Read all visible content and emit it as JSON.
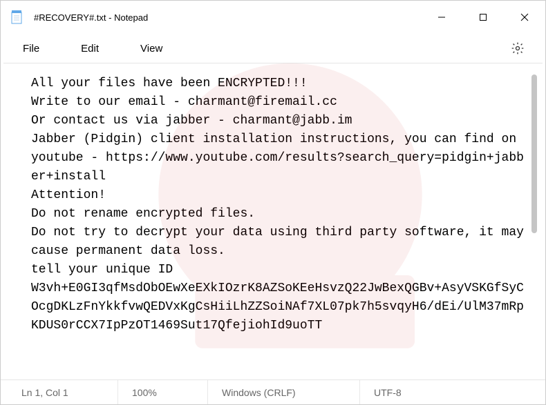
{
  "window": {
    "title": "#RECOVERY#.txt - Notepad"
  },
  "menu": {
    "file": "File",
    "edit": "Edit",
    "view": "View"
  },
  "icons": {
    "notepad": "notepad-icon",
    "minimize": "minimize-icon",
    "maximize": "maximize-icon",
    "close": "close-icon",
    "settings": "gear-icon"
  },
  "document": {
    "text": "All your files have been ENCRYPTED!!!\nWrite to our email - charmant@firemail.cc\nOr contact us via jabber - charmant@jabb.im\nJabber (Pidgin) client installation instructions, you can find on youtube - https://www.youtube.com/results?search_query=pidgin+jabber+install\nAttention!\nDo not rename encrypted files.\nDo not try to decrypt your data using third party software, it may cause permanent data loss.\ntell your unique ID\nW3vh+E0GI3qfMsdObOEwXeEXkIOzrK8AZSoKEeHsvzQ22JwBexQGBv+AsyVSKGfSyCOcgDKLzFnYkkfvwQEDVxKgCsHiiLhZZSoiNAf7XL07pk7h5svqyH6/dEi/UlM37mRpKDUS0rCCX7IpPzOT1469Sut17QfejiohId9uoTT"
  },
  "status": {
    "position": "Ln 1, Col 1",
    "zoom": "100%",
    "line_ending": "Windows (CRLF)",
    "encoding": "UTF-8"
  }
}
